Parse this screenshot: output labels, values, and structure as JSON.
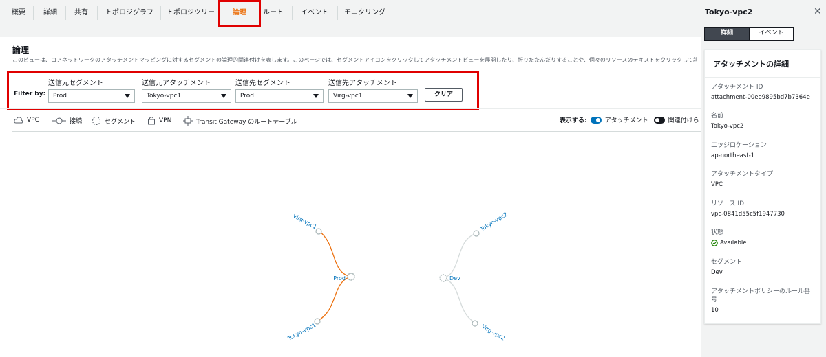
{
  "tabs": [
    {
      "label": "概要",
      "active": false
    },
    {
      "label": "詳細",
      "active": false
    },
    {
      "label": "共有",
      "active": false
    },
    {
      "label": "トポロジグラフ",
      "active": false
    },
    {
      "label": "トポロジツリー",
      "active": false
    },
    {
      "label": "論理",
      "active": true
    },
    {
      "label": "ルート",
      "active": false
    },
    {
      "label": "イベント",
      "active": false
    },
    {
      "label": "モニタリング",
      "active": false
    }
  ],
  "panel": {
    "title": "論理",
    "description": "このビューは、コアネットワークのアタッチメントマッピングに対するセグメントの論理的関連付けを表します。このページでは、セグメントアイコンをクリックしてアタッチメントビューを展開したり、折りたたんだりすることや、個々のリソースのテキストをクリックして詳細を表示することができます。"
  },
  "filters": {
    "label": "Filter by:",
    "fields": [
      {
        "label": "送信元セグメント",
        "value": "Prod"
      },
      {
        "label": "送信元アタッチメント",
        "value": "Tokyo-vpc1"
      },
      {
        "label": "送信先セグメント",
        "value": "Prod"
      },
      {
        "label": "送信先アタッチメント",
        "value": "Virg-vpc1"
      }
    ],
    "clear_label": "クリア"
  },
  "legend": {
    "items": [
      {
        "label": "VPC",
        "icon": "vpc-icon"
      },
      {
        "label": "接続",
        "icon": "connect-icon"
      },
      {
        "label": "セグメント",
        "icon": "segment-icon"
      },
      {
        "label": "VPN",
        "icon": "vpn-icon"
      },
      {
        "label": "Transit Gateway のルートテーブル",
        "icon": "tgw-route-table-icon"
      }
    ],
    "show_label": "表示する:",
    "toggles": [
      {
        "label": "アタッチメント",
        "on": true
      },
      {
        "label": "関連付けら",
        "on": false
      }
    ]
  },
  "graph": {
    "segments": [
      {
        "name": "Prod",
        "highlighted": true
      },
      {
        "name": "Dev",
        "highlighted": false
      }
    ],
    "attachments": [
      {
        "name": "Virg-vpc1",
        "segment": "Prod"
      },
      {
        "name": "Tokyo-vpc1",
        "segment": "Prod"
      },
      {
        "name": "Tokyo-vpc2",
        "segment": "Dev"
      },
      {
        "name": "Virg-vpc2",
        "segment": "Dev"
      }
    ],
    "colors": {
      "highlight": "#ec7211",
      "normal": "#d5dbdb",
      "label": "#0073bb"
    }
  },
  "right_panel": {
    "title": "Tokyo-vpc2",
    "tabs": [
      {
        "label": "詳細",
        "active": true
      },
      {
        "label": "イベント",
        "active": false
      }
    ],
    "card_title": "アタッチメントの詳細",
    "details": [
      {
        "key": "アタッチメント ID",
        "value": "attachment-00ee9895bd7b7364e"
      },
      {
        "key": "名前",
        "value": "Tokyo-vpc2"
      },
      {
        "key": "エッジロケーション",
        "value": "ap-northeast-1"
      },
      {
        "key": "アタッチメントタイプ",
        "value": "VPC"
      },
      {
        "key": "リソース ID",
        "value": "vpc-0841d55c5f1947730"
      },
      {
        "key": "状態",
        "value": "Available"
      },
      {
        "key": "セグメント",
        "value": "Dev"
      },
      {
        "key": "アタッチメントポリシーのルール番号",
        "value": "10"
      }
    ]
  },
  "colors": {
    "accent": "#ec7211",
    "highlight_border": "#e00000",
    "toggle_on": "#0073bb",
    "toggle_off": "#16191f",
    "available": "#1d8102"
  }
}
